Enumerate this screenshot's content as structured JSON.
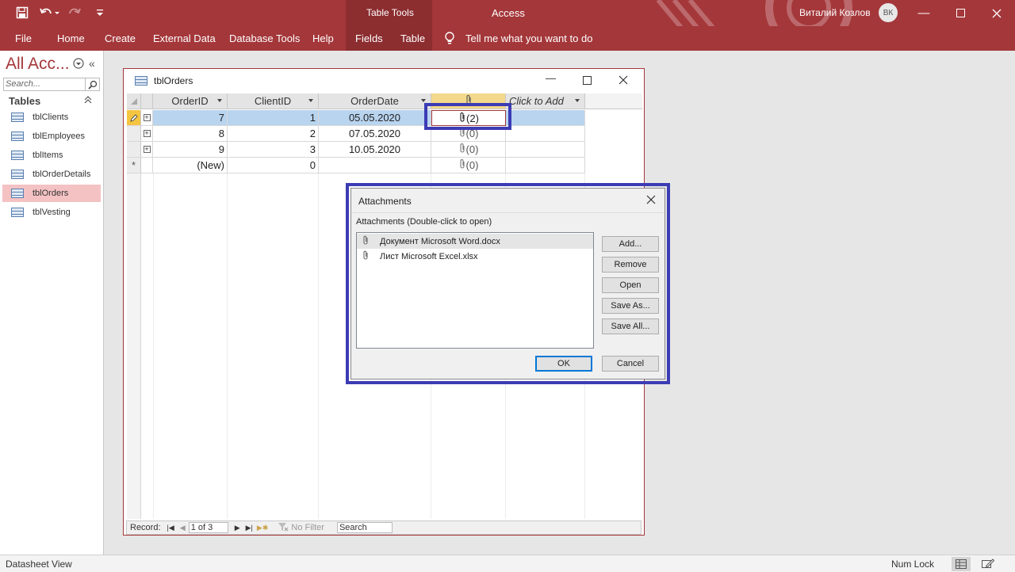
{
  "app": {
    "title": "Access",
    "context_tab_group": "Table Tools",
    "user_name": "Виталий Козлов",
    "user_initials": "ВК",
    "accent_color": "#a4373a"
  },
  "ribbon": {
    "tabs": [
      "File",
      "Home",
      "Create",
      "External Data",
      "Database Tools",
      "Help",
      "Fields",
      "Table"
    ],
    "tell_me": "Tell me what you want to do"
  },
  "nav": {
    "title": "All Acc...",
    "search_placeholder": "Search...",
    "group": "Tables",
    "items": [
      "tblClients",
      "tblEmployees",
      "tblItems",
      "tblOrderDetails",
      "tblOrders",
      "tblVesting"
    ],
    "active_item": "tblOrders"
  },
  "table_window": {
    "title": "tblOrders",
    "columns": [
      "OrderID",
      "ClientID",
      "OrderDate",
      "",
      "Click to Add"
    ],
    "rows": [
      {
        "order_id": "7",
        "client_id": "1",
        "order_date": "05.05.2020",
        "attachments": "(2)"
      },
      {
        "order_id": "8",
        "client_id": "2",
        "order_date": "07.05.2020",
        "attachments": "(0)"
      },
      {
        "order_id": "9",
        "client_id": "3",
        "order_date": "10.05.2020",
        "attachments": "(0)"
      }
    ],
    "new_row": {
      "order_id": "(New)",
      "client_id": "0",
      "attachments": "(0)"
    },
    "record_nav": {
      "label": "Record:",
      "position": "1 of 3",
      "filter": "No Filter",
      "search": "Search"
    }
  },
  "attachments_dialog": {
    "title": "Attachments",
    "subtitle": "Attachments (Double-click to open)",
    "files": [
      "Документ Microsoft Word.docx",
      "Лист Microsoft Excel.xlsx"
    ],
    "buttons": {
      "add": "Add...",
      "remove": "Remove",
      "open": "Open",
      "save_as": "Save As...",
      "save_all": "Save All...",
      "ok": "OK",
      "cancel": "Cancel"
    }
  },
  "status": {
    "view": "Datasheet View",
    "num_lock": "Num Lock"
  }
}
